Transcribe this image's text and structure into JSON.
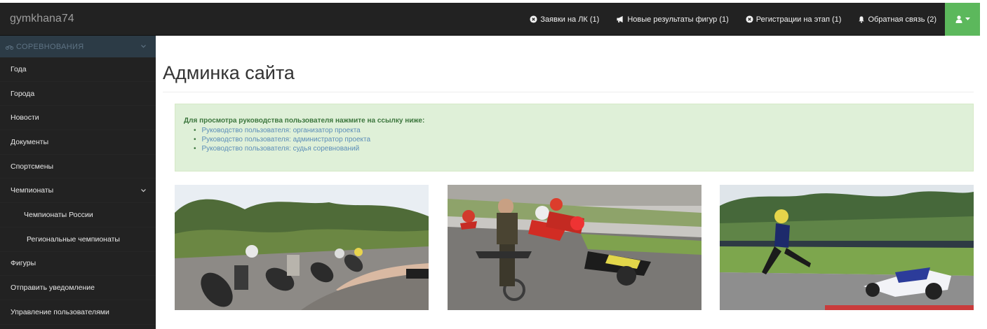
{
  "app": {
    "brand": "gymkhana74"
  },
  "topnav": {
    "items": [
      {
        "label": "Заявки на ЛК (1)",
        "icon": "circle-cross-icon"
      },
      {
        "label": "Новые результаты фигур (1)",
        "icon": "megaphone-icon"
      },
      {
        "label": "Регистрации на этап (1)",
        "icon": "circle-cross-icon"
      },
      {
        "label": "Обратная связь (2)",
        "icon": "bell-icon"
      }
    ],
    "user_icon": "user-icon",
    "accent": "#5cb85c"
  },
  "sidebar": {
    "section": "СОРЕВНОВАНИЯ",
    "items": [
      {
        "label": "Года"
      },
      {
        "label": "Города"
      },
      {
        "label": "Новости"
      },
      {
        "label": "Документы"
      },
      {
        "label": "Спортсмены"
      },
      {
        "label": "Чемпионаты"
      },
      {
        "label": "Чемпионаты России"
      },
      {
        "label": "Региональные чемпионаты"
      },
      {
        "label": "Фигуры"
      },
      {
        "label": "Отправить уведомление"
      },
      {
        "label": "Управление пользователями"
      }
    ]
  },
  "main": {
    "title": "Админка сайта",
    "alert": {
      "heading": "Для просмотра руководства пользователя нажмите на ссылку ниже:",
      "links": [
        "Руководство пользователя: организатор проекта",
        "Руководство пользователя: администратор проекта",
        "Руководство пользователя: судья соревнований"
      ],
      "bg_color": "#dff0d8"
    }
  }
}
